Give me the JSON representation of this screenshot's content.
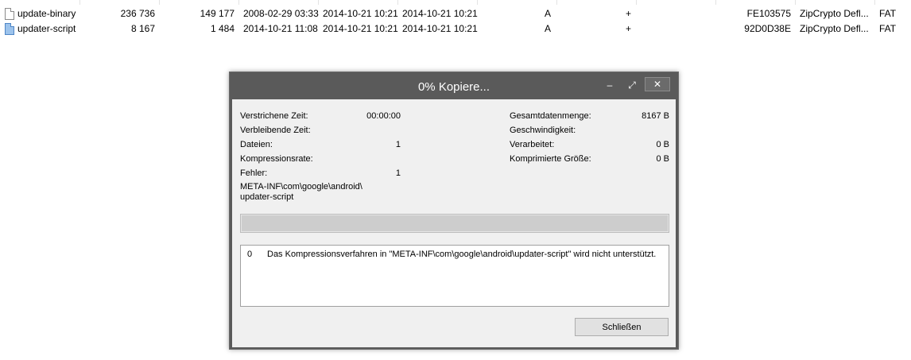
{
  "files": [
    {
      "icon": "file-icon",
      "name": "update-binary",
      "size": "236 736",
      "packed_size": "149 177",
      "modified": "2008-02-29 03:33",
      "created": "2014-10-21 10:21",
      "accessed": "2014-10-21 10:21",
      "attributes": "A",
      "encrypted": "+",
      "crc": "FE103575",
      "method": "ZipCrypto Defl...",
      "host_os": "FAT"
    },
    {
      "icon": "script-file-icon",
      "name": "updater-script",
      "size": "8 167",
      "packed_size": "1 484",
      "modified": "2014-10-21 11:08",
      "created": "2014-10-21 10:21",
      "accessed": "2014-10-21 10:21",
      "attributes": "A",
      "encrypted": "+",
      "crc": "92D0D38E",
      "method": "ZipCrypto Defl...",
      "host_os": "FAT"
    }
  ],
  "dialog": {
    "title": "0% Kopiere...",
    "titlebar_buttons": {
      "minimize": "‒",
      "maximize": "⤢",
      "close": "✕"
    },
    "left_stats": [
      {
        "label": "Verstrichene Zeit:",
        "value": "00:00:00"
      },
      {
        "label": "Verbleibende Zeit:",
        "value": ""
      },
      {
        "label": "Dateien:",
        "value": "1"
      },
      {
        "label": "Kompressionsrate:",
        "value": ""
      },
      {
        "label": "Fehler:",
        "value": "1"
      }
    ],
    "right_stats": [
      {
        "label": "Gesamtdatenmenge:",
        "value": "8167 B"
      },
      {
        "label": "Geschwindigkeit:",
        "value": ""
      },
      {
        "label": "Verarbeitet:",
        "value": "0 B"
      },
      {
        "label": "Komprimierte Größe:",
        "value": "0 B"
      }
    ],
    "current_path_line1": "META-INF\\com\\google\\android\\",
    "current_path_line2": "updater-script",
    "progress_percent": 0,
    "log": [
      {
        "index": "0",
        "message": "Das Kompressionsverfahren in \"META-INF\\com\\google\\android\\updater-script\" wird nicht unterstützt."
      }
    ],
    "close_button_label": "Schließen"
  }
}
